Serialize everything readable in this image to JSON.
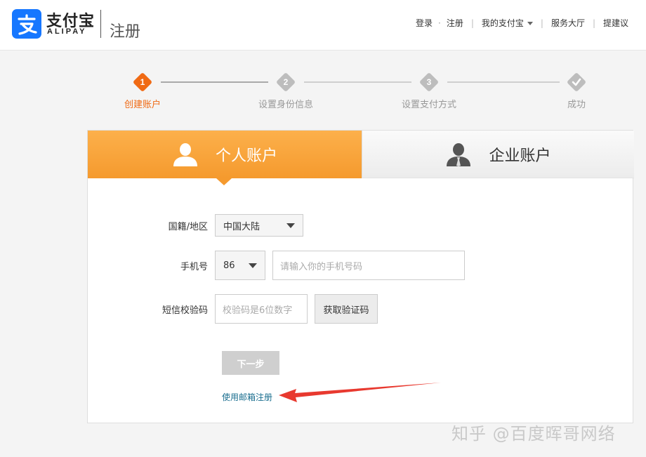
{
  "header": {
    "logo_cn": "支付宝",
    "logo_en": "ALIPAY",
    "page_title": "注册",
    "nav": {
      "login": "登录",
      "dot": "·",
      "register": "注册",
      "my_alipay": "我的支付宝",
      "service_hall": "服务大厅",
      "suggest": "提建议"
    }
  },
  "steps": [
    {
      "num": "1",
      "label": "创建账户",
      "active": true
    },
    {
      "num": "2",
      "label": "设置身份信息",
      "active": false
    },
    {
      "num": "3",
      "label": "设置支付方式",
      "active": false
    },
    {
      "num": "",
      "label": "成功",
      "active": false
    }
  ],
  "tabs": {
    "personal": "个人账户",
    "business": "企业账户"
  },
  "form": {
    "nationality_label": "国籍/地区",
    "nationality_value": "中国大陆",
    "phone_label": "手机号",
    "country_code": "86",
    "phone_placeholder": "请输入你的手机号码",
    "sms_label": "短信校验码",
    "sms_placeholder": "校验码是6位数字",
    "get_code_button": "获取验证码",
    "next_button": "下一步",
    "email_register_link": "使用邮箱注册"
  },
  "watermark": "知乎 @百度晖哥网络",
  "colors": {
    "accent_orange": "#f59a2e",
    "step_active": "#f06a14",
    "alipay_blue": "#1677ff",
    "arrow_red": "#e8392f",
    "link": "#1a6e8f"
  }
}
